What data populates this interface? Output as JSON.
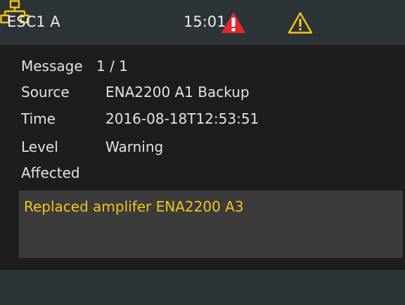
{
  "header": {
    "device_name": "ESC1 A",
    "time": "15:01",
    "icons": {
      "alarm": "alarm-triangle-icon",
      "warning": "warning-triangle-icon",
      "network": "network-icon"
    },
    "colors": {
      "alarm": "#e5282d",
      "warning": "#f3c41a",
      "network": "#f3c41a"
    }
  },
  "details": {
    "message_label": "Message",
    "message_index": "1 / 1",
    "source_label": "Source",
    "source_value": "ENA2200 A1 Backup",
    "time_label": "Time",
    "time_value": "2016-08-18T12:53:51",
    "level_label": "Level",
    "level_value": "Warning",
    "affected_label": "Affected"
  },
  "message": {
    "text": "Replaced amplifer ENA2200 A3",
    "color": "#f3c41a"
  }
}
